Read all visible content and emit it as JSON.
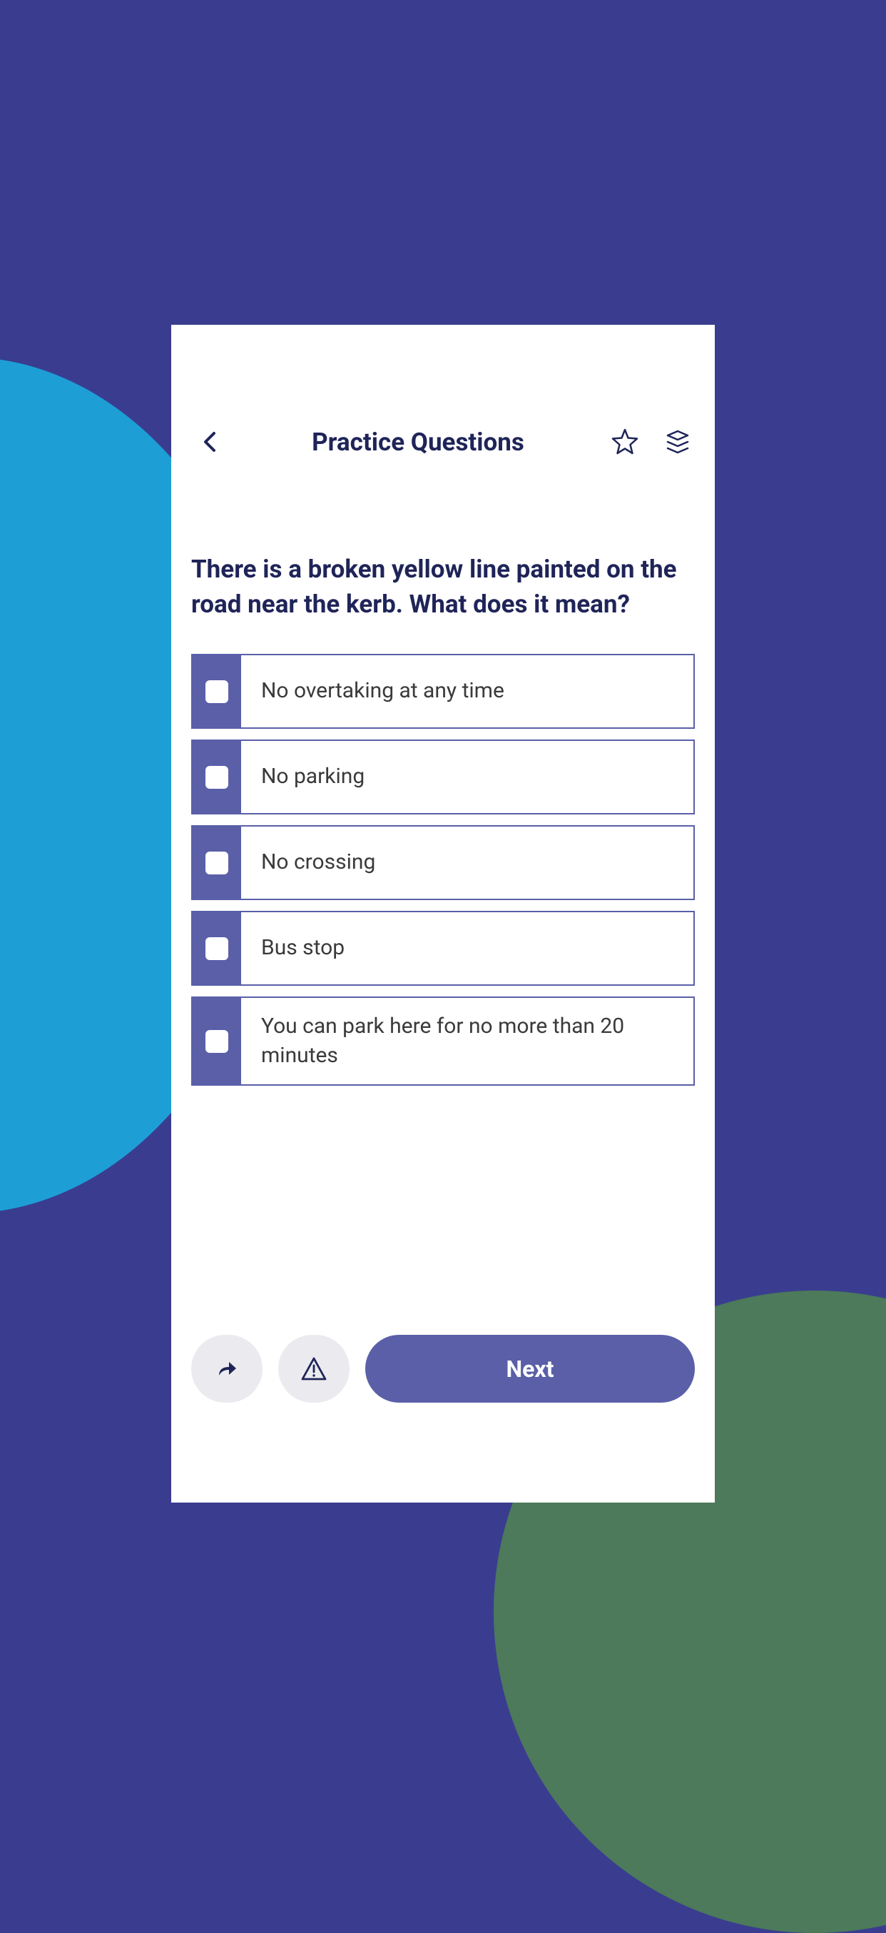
{
  "header": {
    "title": "Practice Questions"
  },
  "question": {
    "text": "There is a broken yellow line painted on the road near the kerb. What does it mean?",
    "options": [
      "No overtaking at any time",
      "No parking",
      "No crossing",
      "Bus stop",
      "You can park here for no more than 20 minutes"
    ]
  },
  "footer": {
    "next_label": "Next"
  }
}
